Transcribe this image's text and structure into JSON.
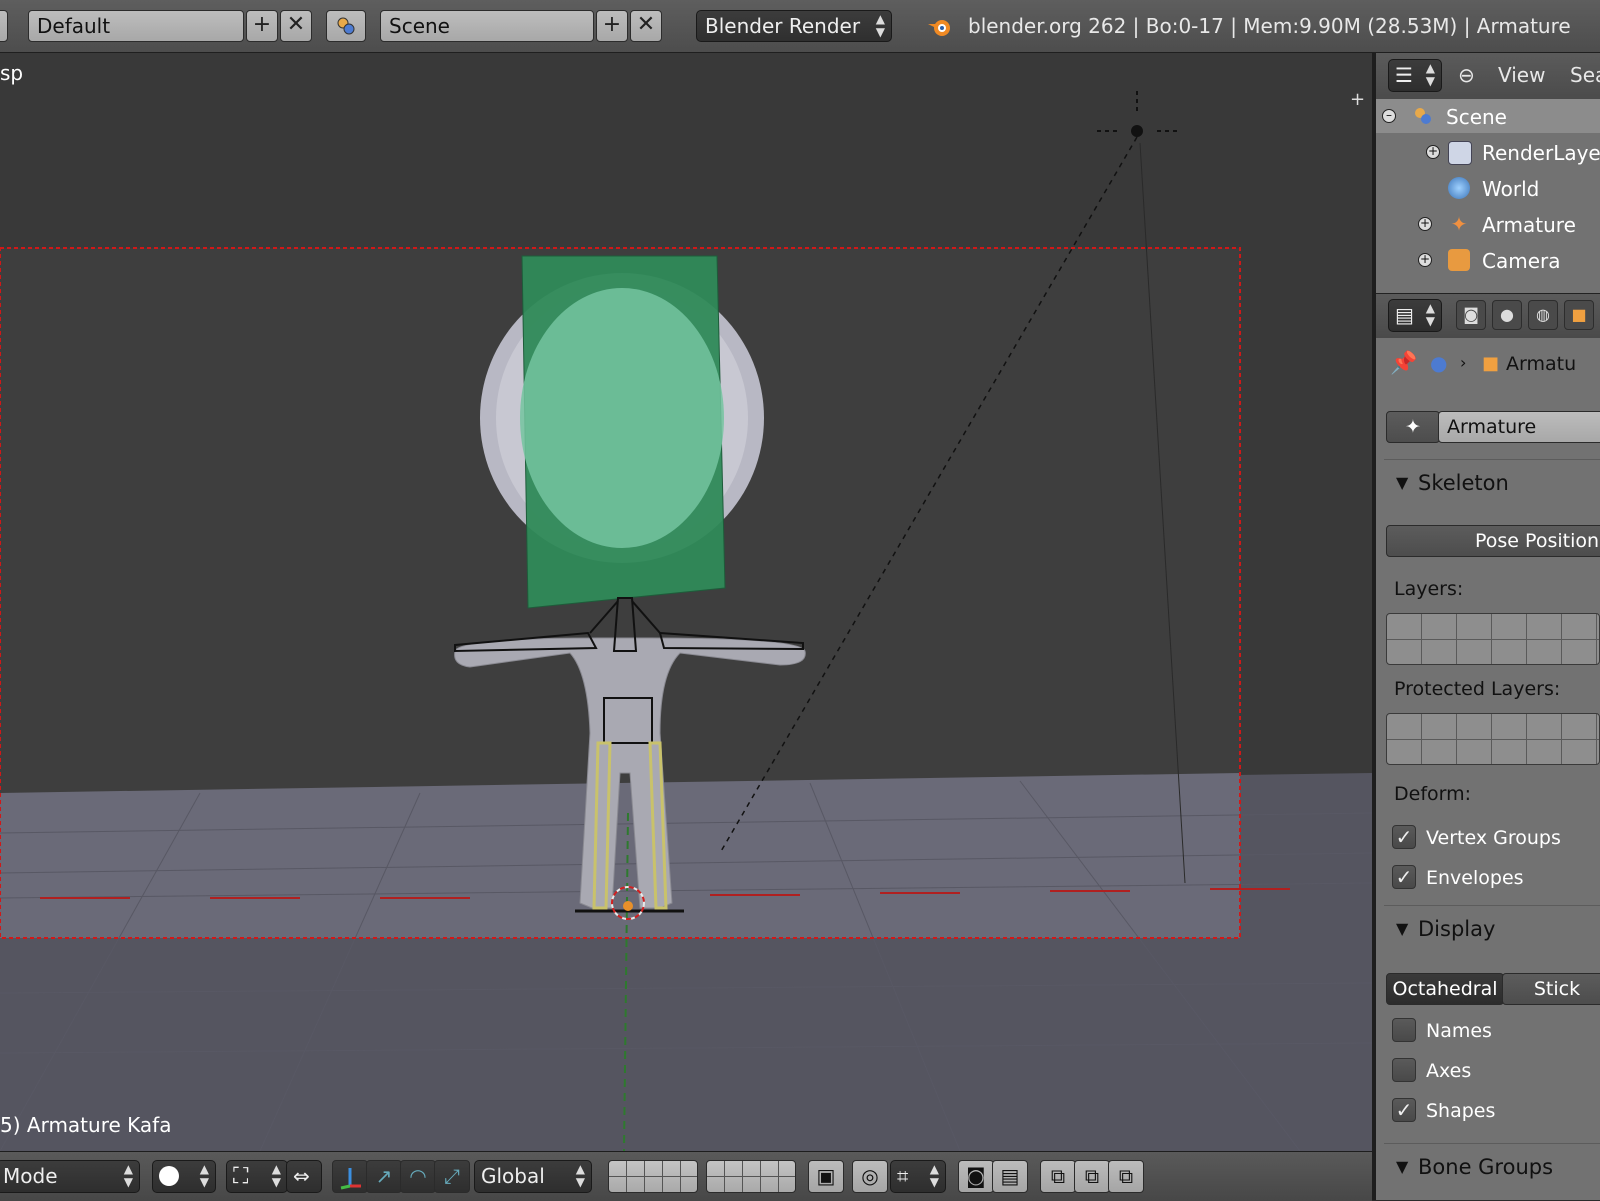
{
  "header": {
    "screen_layout": "Default",
    "scene": "Scene",
    "render_engine": "Blender Render",
    "info": "blender.org 262 | Bo:0-17  | Mem:9.90M (28.53M) | Armature",
    "icons": {
      "add": "plus-icon",
      "remove": "close-icon",
      "scene": "scene-icon",
      "logo": "blender-logo-icon"
    }
  },
  "viewport": {
    "view_label": "sp",
    "object_label": "5) Armature Kafa",
    "footer": {
      "mode": "Mode",
      "orientation": "Global",
      "icons": [
        "viewport-shading-icon",
        "pivot-icon",
        "manipulator-icon",
        "translate-icon",
        "rotate-icon",
        "scale-icon",
        "layers-icon",
        "lock-icon",
        "proportional-icon",
        "snap-icon",
        "render-icon",
        "clapboard-icon",
        "copy-icon",
        "paste-icon",
        "paste-flipped-icon"
      ]
    },
    "colors": {
      "background": "#393939",
      "floor": "#6a6a78",
      "head_bone": "#2f8a58",
      "camera_border": "#d11818"
    }
  },
  "outliner": {
    "view_menu": "View",
    "search_menu": "Sea",
    "items": [
      {
        "label": "Scene",
        "icon": "scene-icon"
      },
      {
        "label": "RenderLayers",
        "icon": "render-layers-icon"
      },
      {
        "label": "World",
        "icon": "world-icon"
      },
      {
        "label": "Armature",
        "icon": "armature-icon"
      },
      {
        "label": "Camera",
        "icon": "camera-icon"
      }
    ]
  },
  "properties": {
    "breadcrumb": "Armatu",
    "object_name": "Armature",
    "skeleton": {
      "title": "Skeleton",
      "pose_position": "Pose Position",
      "layers_label": "Layers:",
      "protected_label": "Protected Layers:"
    },
    "deform": {
      "label": "Deform:",
      "vertex_groups": {
        "label": "Vertex Groups",
        "checked": true
      },
      "envelopes": {
        "label": "Envelopes",
        "checked": true
      }
    },
    "display": {
      "title": "Display",
      "octahedral": "Octahedral",
      "stick": "Stick",
      "names": {
        "label": "Names",
        "checked": false
      },
      "axes": {
        "label": "Axes",
        "checked": false
      },
      "shapes": {
        "label": "Shapes",
        "checked": true
      }
    },
    "bone_groups": {
      "title": "Bone Groups"
    }
  }
}
